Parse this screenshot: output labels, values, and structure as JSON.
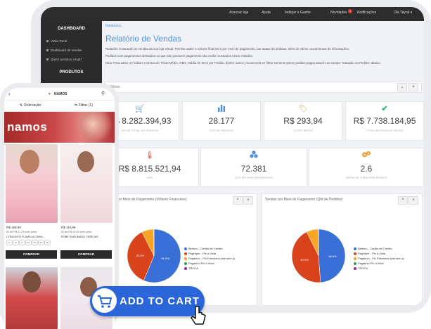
{
  "topbar": {
    "items": [
      "Acessar loja",
      "Ajuda",
      "Indique e Ganhe",
      "Novidades",
      "Notificações",
      "Olá Tayná ▾"
    ],
    "badge": "1"
  },
  "sidebar": {
    "dashboard_title": "DASHBOARD",
    "items": [
      "Visão Geral",
      "Dashboard de Vendas",
      "Quem acessou a loja?"
    ],
    "products_title": "PRODUTOS"
  },
  "breadcrumb": "Relatórios",
  "page_title": "Relatório de Vendas",
  "description": [
    "Relatório mostrando as vendas da sua loja virtual. Permite saber o volume financeiro por meio de pagamento, por status de pedidos, além de vários cruzamentos de informações.",
    "Pedidos com pagamentos deletados ou que não possuem pagamento não serão mostrados nesse relatório.",
    "Dica: Para saber os índices corretos de Ticket Médio, GMV, Média de Itens por Pedido, dentre outros, recomenda-se filtrar somente pelos pedidos pagos através do campo \"Situação do Pedido\" abaixo."
  ],
  "filters_label": "Filtros",
  "kpis_row1": [
    {
      "value": "R$ 8.282.394,93",
      "label": "VALOR TOTAL EM PEDIDOS",
      "icon": "cart-icon",
      "color": "#4f8fd6"
    },
    {
      "value": "28.177",
      "label": "QTD DE PEDIDOS",
      "icon": "bar-chart-icon",
      "color": "#4f8fd6"
    },
    {
      "value": "R$ 293,94",
      "label": "TICKET MÉDIO",
      "icon": "tag-icon",
      "color": "#f0a030"
    },
    {
      "value": "R$ 7.738.184,95",
      "label": "TOTAL EM PEDIDOS PAGOS",
      "icon": "check-icon",
      "color": "#2bb673"
    }
  ],
  "kpis_row2": [
    {
      "value": "R$ 8.815.521,94",
      "label": "GMV",
      "icon": "thermometer-icon",
      "color": "#e0453a"
    },
    {
      "value": "72.381",
      "label": "QTD DE ITENS EM PEDIDOS",
      "icon": "cubes-icon",
      "color": "#4f8fd6"
    },
    {
      "value": "2.6",
      "label": "MÉDIA DE ITENS POR PEDIDO",
      "icon": "gears-icon",
      "color": "#f0a030"
    }
  ],
  "charts": {
    "left_title": "Vendas por Meio de Pagamento (Volume Financeiro)",
    "right_title": "Vendas por Meio de Pagamento (Qtd de Pedidos)",
    "legend": [
      {
        "name": "Beltuno - Cartão de Crédito",
        "color": "#3a6fd8"
      },
      {
        "name": "PagHiper - Pix à Vista",
        "color": "#d9431c"
      },
      {
        "name": "Pagalevo - Pix Parcelado (até sem ju",
        "color": "#f6a623"
      },
      {
        "name": "Pagalevo Pix à Vista",
        "color": "#2e9a45"
      },
      {
        "name": "TROCA",
        "color": "#8e2aa0"
      }
    ],
    "left_labels": [
      "56.3%",
      "36.3%"
    ],
    "right_labels": [
      "48.8%",
      "43.9%"
    ]
  },
  "chart_data": [
    {
      "type": "pie",
      "title": "Vendas por Meio de Pagamento (Volume Financeiro)",
      "categories": [
        "Beltuno - Cartão de Crédito",
        "PagHiper - Pix à Vista",
        "Pagalevo - Pix Parcelado (até sem ju",
        "Pagalevo Pix à Vista",
        "TROCA"
      ],
      "values": [
        56.3,
        36.3,
        7.2,
        0.1,
        0.1
      ]
    },
    {
      "type": "pie",
      "title": "Vendas por Meio de Pagamento (Qtd de Pedidos)",
      "categories": [
        "Beltuno - Cartão de Crédito",
        "PagHiper - Pix à Vista",
        "Pagalevo - Pix Parcelado (até sem ju",
        "Pagalevo Pix à Vista",
        "TROCA"
      ],
      "values": [
        48.8,
        43.9,
        7.1,
        0.1,
        0.1
      ]
    }
  ],
  "phone": {
    "brand": "NAMOS",
    "sort_label": "Ordenação",
    "filter_label": "Filtrar (1)",
    "banner_text": "namos",
    "products": [
      {
        "price": "R$ 169,99",
        "installment": "6x de R$ 21,25 sem juros",
        "name": "CONJUNTO FLAMA ALCINHA..."
      },
      {
        "price": "R$ 119,99",
        "installment": "6x de R$ 20,00 sem juros",
        "name": "ROBE SUBLIMADO CEREJAS"
      }
    ],
    "sizes": [
      "P",
      "M",
      "G",
      "GG",
      "XG",
      "2G",
      "3G"
    ],
    "buy_label": "COMPRAR"
  },
  "cta": {
    "label": "ADD TO CART"
  }
}
